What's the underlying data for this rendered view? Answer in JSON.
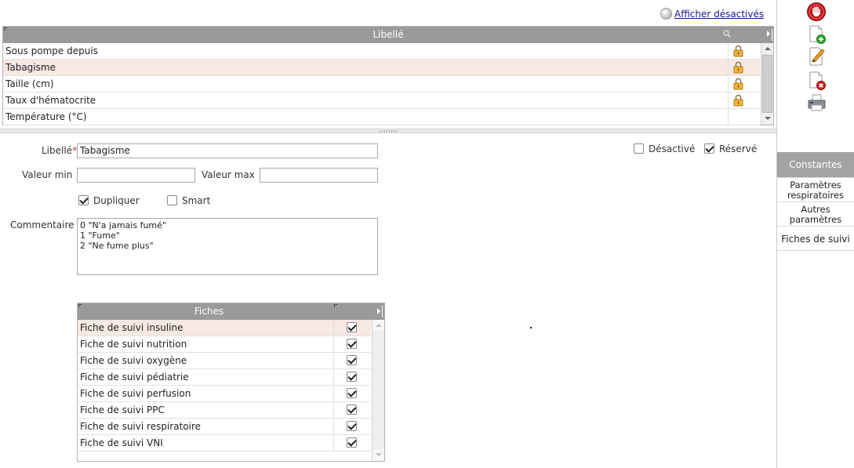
{
  "top_link": {
    "label": "Afficher désactivés"
  },
  "main_grid": {
    "column_header": "Libellé",
    "rows": [
      {
        "label": "Sous pompe depuis",
        "locked": true
      },
      {
        "label": "Tabagisme",
        "locked": true,
        "selected": true
      },
      {
        "label": "Taille (cm)",
        "locked": true
      },
      {
        "label": "Taux d'hématocrite",
        "locked": true
      },
      {
        "label": "Température (°C)",
        "locked": false
      }
    ]
  },
  "form": {
    "libelle_label": "Libellé",
    "required_mark": "*",
    "libelle_value": "Tabagisme",
    "valeur_min_label": "Valeur min",
    "valeur_min_value": "",
    "valeur_max_label": "Valeur max",
    "valeur_max_value": "",
    "dupliquer_label": "Dupliquer",
    "dupliquer_checked": true,
    "smart_label": "Smart",
    "smart_checked": false,
    "desactive_label": "Désactivé",
    "desactive_checked": false,
    "reserve_label": "Réservé",
    "reserve_checked": true,
    "commentaire_label": "Commentaire",
    "commentaire_value": "0 \"N'a jamais fumé\"\n1 \"Fume\"\n2 \"Ne fume plus\""
  },
  "fiches_grid": {
    "column_header": "Fiches",
    "rows": [
      {
        "label": "Fiche de suivi insuline",
        "checked": true,
        "selected": true
      },
      {
        "label": "Fiche de suivi nutrition",
        "checked": true
      },
      {
        "label": "Fiche de suivi oxygène",
        "checked": true
      },
      {
        "label": "Fiche de suivi pédiatrie",
        "checked": true
      },
      {
        "label": "Fiche de suivi perfusion",
        "checked": true
      },
      {
        "label": "Fiche de suivi PPC",
        "checked": true
      },
      {
        "label": "Fiche de suivi respiratoire",
        "checked": true
      },
      {
        "label": "Fiche de suivi VNI",
        "checked": true
      }
    ]
  },
  "toolbar": {
    "icons": [
      "stop-icon",
      "add-document-icon",
      "edit-document-icon",
      "delete-document-icon",
      "print-icon"
    ]
  },
  "side_tabs": [
    {
      "label": "Constantes",
      "active": true
    },
    {
      "label": "Paramètres respiratoires",
      "active": false
    },
    {
      "label": "Autres paramètres",
      "active": false
    },
    {
      "label": "Fiches de suivi",
      "active": false
    }
  ]
}
